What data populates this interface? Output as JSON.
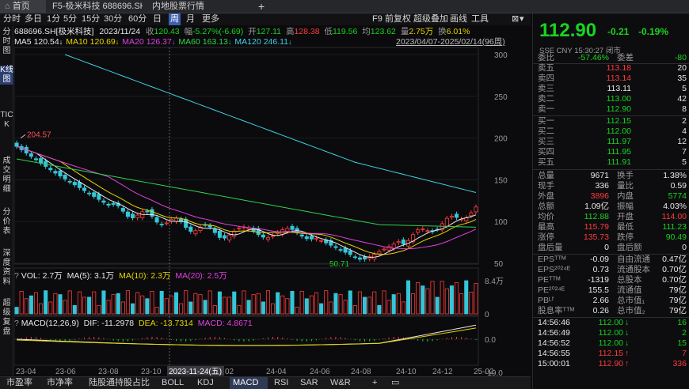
{
  "tabs": [
    {
      "label": "首页"
    },
    {
      "label": "F5-极米科技 688696.SH"
    },
    {
      "label": "内地股票行情"
    }
  ],
  "add_tab": "+",
  "toolbar": {
    "items": [
      "分时",
      "多日",
      "1分",
      "5分",
      "15分",
      "30分",
      "60分",
      "日",
      "周",
      "月",
      "更多"
    ],
    "selected": "周",
    "right": [
      "F9",
      "前复权",
      "超级叠加",
      "画线",
      "工具"
    ]
  },
  "left_nav": [
    "分时图",
    "K线图",
    "TICK",
    "成交明细",
    "分价表",
    "深度资料",
    "超级复盘"
  ],
  "quote_line": {
    "name": "688696.SH[极米科技]",
    "date": "2023/11/24",
    "open_label": "收",
    "open_value": "120.43",
    "amp_label": "幅",
    "amp_value": "-5.27%(-6.69)",
    "high_label": "开",
    "high_value": "127.11",
    "hi_label": "高",
    "hi_value": "128.38",
    "lo_label": "低",
    "lo_value": "119.56",
    "avg_label": "均",
    "avg_value": "123.62",
    "vol_label": "量",
    "vol_value": "2.75万",
    "turn_label": "换",
    "turn_value": "6.01%"
  },
  "ma_line": [
    {
      "label": "MA5",
      "value": "120.54",
      "color": "#e8e8e8"
    },
    {
      "label": "MA10",
      "value": "120.69",
      "color": "#e6d400"
    },
    {
      "label": "MA20",
      "value": "126.37",
      "color": "#e040e0"
    },
    {
      "label": "MA60",
      "value": "163.13",
      "color": "#2fd34a"
    },
    {
      "label": "MA120",
      "value": "246.11",
      "color": "#3fd0e0"
    }
  ],
  "range_label": "2023/04/07-2025/02/14(96周)",
  "price_axis": [
    "300",
    "250",
    "200",
    "150",
    "100",
    "50"
  ],
  "max_label": "204.57",
  "min_label": "50.71",
  "vol_line": {
    "label": "VOL: 2.7万",
    "ma5": "MA(5): 3.1万",
    "ma10": "MA(10): 2.3万",
    "ma20": "MA(20): 2.5万"
  },
  "vol_axis": [
    "8.4万",
    "0"
  ],
  "macd_line": {
    "label": "MACD(12,26,9)",
    "dif": "DIF: -11.2978",
    "dea": "DEA: -13.7314",
    "macd": "MACD: 4.8671"
  },
  "macd_axis": [
    "0.0",
    "-19.0"
  ],
  "x_axis": [
    "23-04",
    "23-06",
    "23-08",
    "23-10",
    "2023-11-24(五)",
    "02",
    "24-04",
    "24-06",
    "24-08",
    "24-10",
    "24-12",
    "25-02"
  ],
  "bottom_tabs": [
    "市盈率",
    "市净率",
    "陆股通持股占比",
    "BOLL",
    "KDJ",
    "MACD",
    "RSI",
    "SAR",
    "W&R"
  ],
  "bottom_selected": "MACD",
  "bottom_add": "+",
  "price": {
    "last": "112.90",
    "change": "-0.21",
    "pct": "-0.19%"
  },
  "status": {
    "market": "SSE",
    "ccy": "CNY",
    "time": "15:30:27",
    "state": "闭市"
  },
  "ratio": {
    "label1": "委比",
    "value1": "-57.46%",
    "label2": "委差",
    "value2": "-80"
  },
  "asks": [
    {
      "label": "卖五",
      "price": "113.18",
      "vol": "20",
      "color": "red"
    },
    {
      "label": "卖四",
      "price": "113.14",
      "vol": "35",
      "color": "red"
    },
    {
      "label": "卖三",
      "price": "113.11",
      "vol": "5",
      "color": "white"
    },
    {
      "label": "卖二",
      "price": "113.00",
      "vol": "42",
      "color": "green"
    },
    {
      "label": "卖一",
      "price": "112.90",
      "vol": "8",
      "color": "green"
    }
  ],
  "bids": [
    {
      "label": "买一",
      "price": "112.15",
      "vol": "2"
    },
    {
      "label": "买二",
      "price": "112.00",
      "vol": "4"
    },
    {
      "label": "买三",
      "price": "111.97",
      "vol": "12"
    },
    {
      "label": "买四",
      "price": "111.95",
      "vol": "7"
    },
    {
      "label": "买五",
      "price": "111.91",
      "vol": "5"
    }
  ],
  "stats": [
    {
      "l1": "总量",
      "v1": "9671",
      "c1": "white",
      "l2": "换手",
      "v2": "1.38%",
      "c2": "white"
    },
    {
      "l1": "现手",
      "v1": "336",
      "c1": "white",
      "l2": "量比",
      "v2": "0.59",
      "c2": "white"
    },
    {
      "l1": "外盘",
      "v1": "3896",
      "c1": "red",
      "l2": "内盘",
      "v2": "5774",
      "c2": "green"
    },
    {
      "l1": "总额",
      "v1": "1.09亿",
      "c1": "white",
      "l2": "振幅",
      "v2": "4.03%",
      "c2": "white"
    },
    {
      "l1": "均价",
      "v1": "112.88",
      "c1": "green",
      "l2": "开盘",
      "v2": "114.00",
      "c2": "red"
    },
    {
      "l1": "最高",
      "v1": "115.79",
      "c1": "red",
      "l2": "最低",
      "v2": "111.23",
      "c2": "green"
    },
    {
      "l1": "涨停",
      "v1": "135.73",
      "c1": "red",
      "l2": "跌停",
      "v2": "90.49",
      "c2": "green"
    },
    {
      "l1": "盘后量",
      "v1": "0",
      "c1": "white",
      "l2": "盘后额",
      "v2": "0",
      "c2": "white"
    }
  ],
  "fundamentals": [
    {
      "l1": "EPSᵀᵀᴹ",
      "v1": "-0.09",
      "l2": "自由流通",
      "v2": "0.47亿"
    },
    {
      "l1": "EPS²⁰²⁴ᴱ",
      "v1": "0.73",
      "l2": "流通股本",
      "v2": "0.70亿"
    },
    {
      "l1": "PEᵀᵀᴹ",
      "v1": "-1319",
      "l2": "总股本",
      "v2": "0.70亿"
    },
    {
      "l1": "PE²⁰²⁴ᴱ",
      "v1": "155.5",
      "l2": "流通值",
      "v2": "79亿"
    },
    {
      "l1": "PBᴸᶠ",
      "v1": "2.66",
      "l2": "总市值₁",
      "v2": "79亿"
    },
    {
      "l1": "股息率ᵀᵀᴹ",
      "v1": "0.26",
      "l2": "总市值₂",
      "v2": "79亿"
    }
  ],
  "ticks": [
    {
      "time": "14:56:46",
      "price": "112.00",
      "dir": "down",
      "vol": "16"
    },
    {
      "time": "14:56:49",
      "price": "112.00",
      "dir": "down",
      "vol": "2"
    },
    {
      "time": "14:56:52",
      "price": "112.00",
      "dir": "down",
      "vol": "15"
    },
    {
      "time": "14:56:55",
      "price": "112.15",
      "dir": "up",
      "vol": "7"
    },
    {
      "time": "15:00:01",
      "price": "112.90",
      "dir": "up",
      "vol": "336"
    }
  ],
  "colors": {
    "up": "#ff3b3b",
    "down": "#19d41f",
    "candle_down": "#34c6d8",
    "accent": "#3b5fb0"
  }
}
